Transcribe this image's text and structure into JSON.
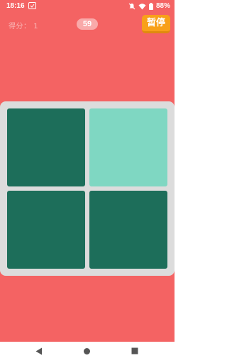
{
  "status_bar": {
    "time": "18:16",
    "battery": "88%",
    "icons": [
      "notification-icon",
      "mute-icon",
      "wifi-icon",
      "battery-icon"
    ]
  },
  "game": {
    "score_label": "得分：",
    "score_value": "1",
    "timer": "59",
    "pause_label": "暂停"
  },
  "board": {
    "tiles": [
      {
        "state": "dark",
        "color": "#1d6e5a"
      },
      {
        "state": "light",
        "color": "#7fd7c2"
      },
      {
        "state": "dark",
        "color": "#1d6e5a"
      },
      {
        "state": "dark",
        "color": "#1d6e5a"
      }
    ]
  },
  "colors": {
    "background": "#f46363",
    "board": "#dcdcdc",
    "tile_dark": "#1d6e5a",
    "tile_light": "#7fd7c2",
    "pause_button": "#f8a019"
  },
  "nav_bar": {
    "icons": [
      "back-icon",
      "home-icon",
      "recents-icon"
    ]
  }
}
